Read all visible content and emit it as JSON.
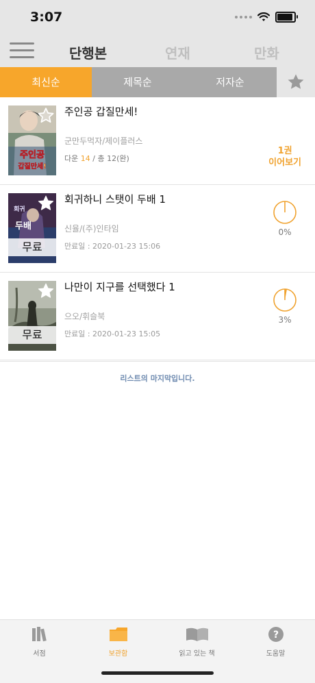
{
  "status_bar": {
    "time": "3:07"
  },
  "header": {
    "tabs": [
      {
        "label": "단행본",
        "active": true
      },
      {
        "label": "연재",
        "active": false
      },
      {
        "label": "만화",
        "active": false
      }
    ]
  },
  "sort_tabs": [
    {
      "label": "최신순",
      "active": true
    },
    {
      "label": "제목순",
      "active": false
    },
    {
      "label": "저자순",
      "active": false
    }
  ],
  "books": [
    {
      "title": "주인공 갑질만세!",
      "author": "군만두먹자/제이플러스",
      "meta_prefix": "다운",
      "meta_count": "14",
      "meta_sep": "/",
      "meta_total": "총 12(완)",
      "continue_line1": "1권",
      "continue_line2": "이어보기"
    },
    {
      "title": "회귀하니 스탯이 두배 1",
      "author": "신율/(주)인타임",
      "badge": "무료",
      "expire": "만료일 : 2020-01-23 15:06",
      "progress_percent": 0,
      "progress_text": "0%"
    },
    {
      "title": "나만이 지구를 선택했다 1",
      "author": "으오/휘슬북",
      "badge": "무료",
      "expire": "만료일 : 2020-01-23 15:05",
      "progress_percent": 3,
      "progress_text": "3%"
    }
  ],
  "list_end": "리스트의 마지막입니다.",
  "bottom_nav": [
    {
      "label": "서점",
      "icon": "bookshelf-icon",
      "active": false
    },
    {
      "label": "보관함",
      "icon": "folder-icon",
      "active": true
    },
    {
      "label": "읽고 있는 책",
      "icon": "open-book-icon",
      "active": false
    },
    {
      "label": "도움말",
      "icon": "help-icon",
      "active": false
    }
  ],
  "colors": {
    "accent": "#f7a62b",
    "inactive_tab": "#a9a9a9",
    "header_bg": "#e6e6e6"
  }
}
